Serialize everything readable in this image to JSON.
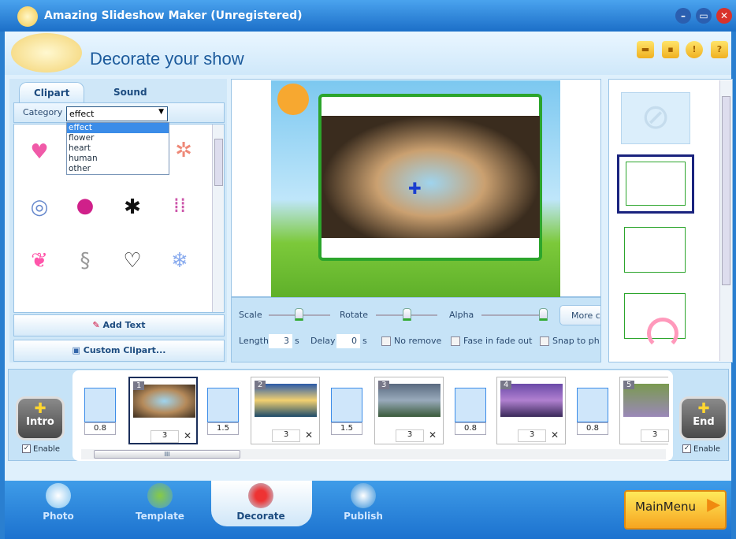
{
  "window": {
    "title": "Amazing Slideshow Maker (Unregistered)"
  },
  "header": {
    "title": "Decorate your show"
  },
  "left": {
    "tabs": [
      "Clipart",
      "Sound"
    ],
    "category_label": "Category",
    "category_value": "effect",
    "category_options": [
      "effect",
      "flower",
      "heart",
      "human",
      "other"
    ],
    "add_text": "Add Text",
    "custom_clipart": "Custom Clipart..."
  },
  "controls": {
    "scale": "Scale",
    "rotate": "Rotate",
    "alpha": "Alpha",
    "scale_level": 0.5,
    "rotate_level": 0.5,
    "alpha_level": 1.0,
    "more": "More c",
    "length_label": "Length",
    "length": "3",
    "delay_label": "Delay",
    "delay": "0",
    "unit": "s",
    "no_remove": "No remove",
    "fade": "Fase in fade out",
    "snap": "Snap to pho"
  },
  "timeline": {
    "intro": "Intro",
    "end": "End",
    "enable": "Enable",
    "transitions": [
      "0.8",
      "1.5",
      "1.5",
      "0.8",
      "0.8"
    ],
    "slides": [
      {
        "n": "1",
        "len": "3"
      },
      {
        "n": "2",
        "len": "3"
      },
      {
        "n": "3",
        "len": "3"
      },
      {
        "n": "4",
        "len": "3"
      },
      {
        "n": "5",
        "len": "3"
      }
    ]
  },
  "nav": {
    "items": [
      "Photo",
      "Template",
      "Decorate",
      "Publish"
    ],
    "main_menu": "MainMenu"
  }
}
